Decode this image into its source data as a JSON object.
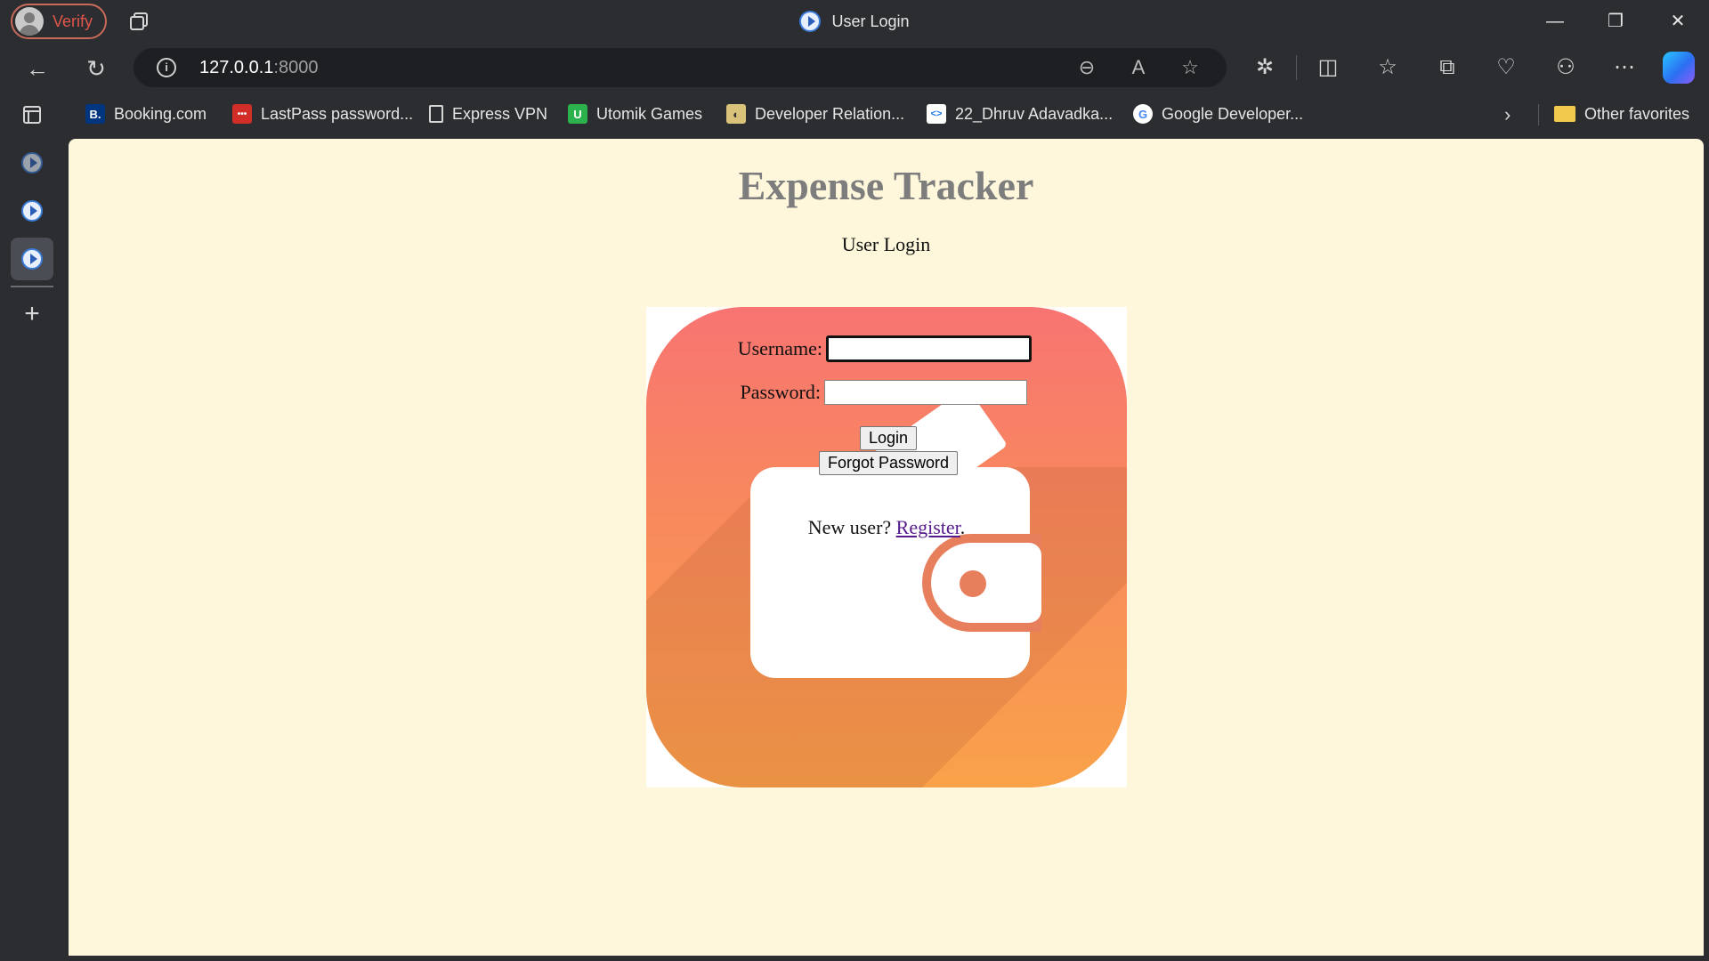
{
  "browser": {
    "profile_label": "Verify",
    "tab_title": "User Login",
    "url_host": "127.0.0.1",
    "url_port": ":8000"
  },
  "favorites": [
    {
      "label": "Booking.com",
      "icon": "booking-icon",
      "color": "#003580",
      "glyph": "B."
    },
    {
      "label": "LastPass password...",
      "icon": "lastpass-icon",
      "color": "#d32d27",
      "glyph": "•••"
    },
    {
      "label": "Express VPN",
      "icon": "page-icon",
      "color": "transparent",
      "glyph": "🗋"
    },
    {
      "label": "Utomik Games",
      "icon": "utomik-icon",
      "color": "#2bb24c",
      "glyph": "U"
    },
    {
      "label": "Developer Relation...",
      "icon": "devrel-icon",
      "color": "#d9c27a",
      "glyph": "◐"
    },
    {
      "label": "22_Dhruv Adavadka...",
      "icon": "code-icon",
      "color": "#ffffff",
      "glyph": "<>"
    },
    {
      "label": "Google Developer...",
      "icon": "google-icon",
      "color": "#ffffff",
      "glyph": "G"
    }
  ],
  "other_favorites": "Other favorites",
  "page": {
    "title": "Expense Tracker",
    "subtitle": "User Login",
    "username_label": "Username:",
    "password_label": "Password:",
    "username_value": "",
    "password_value": "",
    "login_button": "Login",
    "forgot_button": "Forgot Password",
    "new_user_text": "New user? ",
    "register_link": "Register",
    "register_suffix": "."
  },
  "colors": {
    "page_bg": "#fef7dc",
    "title_color": "#7d7d7d",
    "card_gradient_top": "#f87472",
    "card_gradient_bottom": "#f9a24a",
    "link_color": "#551a8b"
  }
}
